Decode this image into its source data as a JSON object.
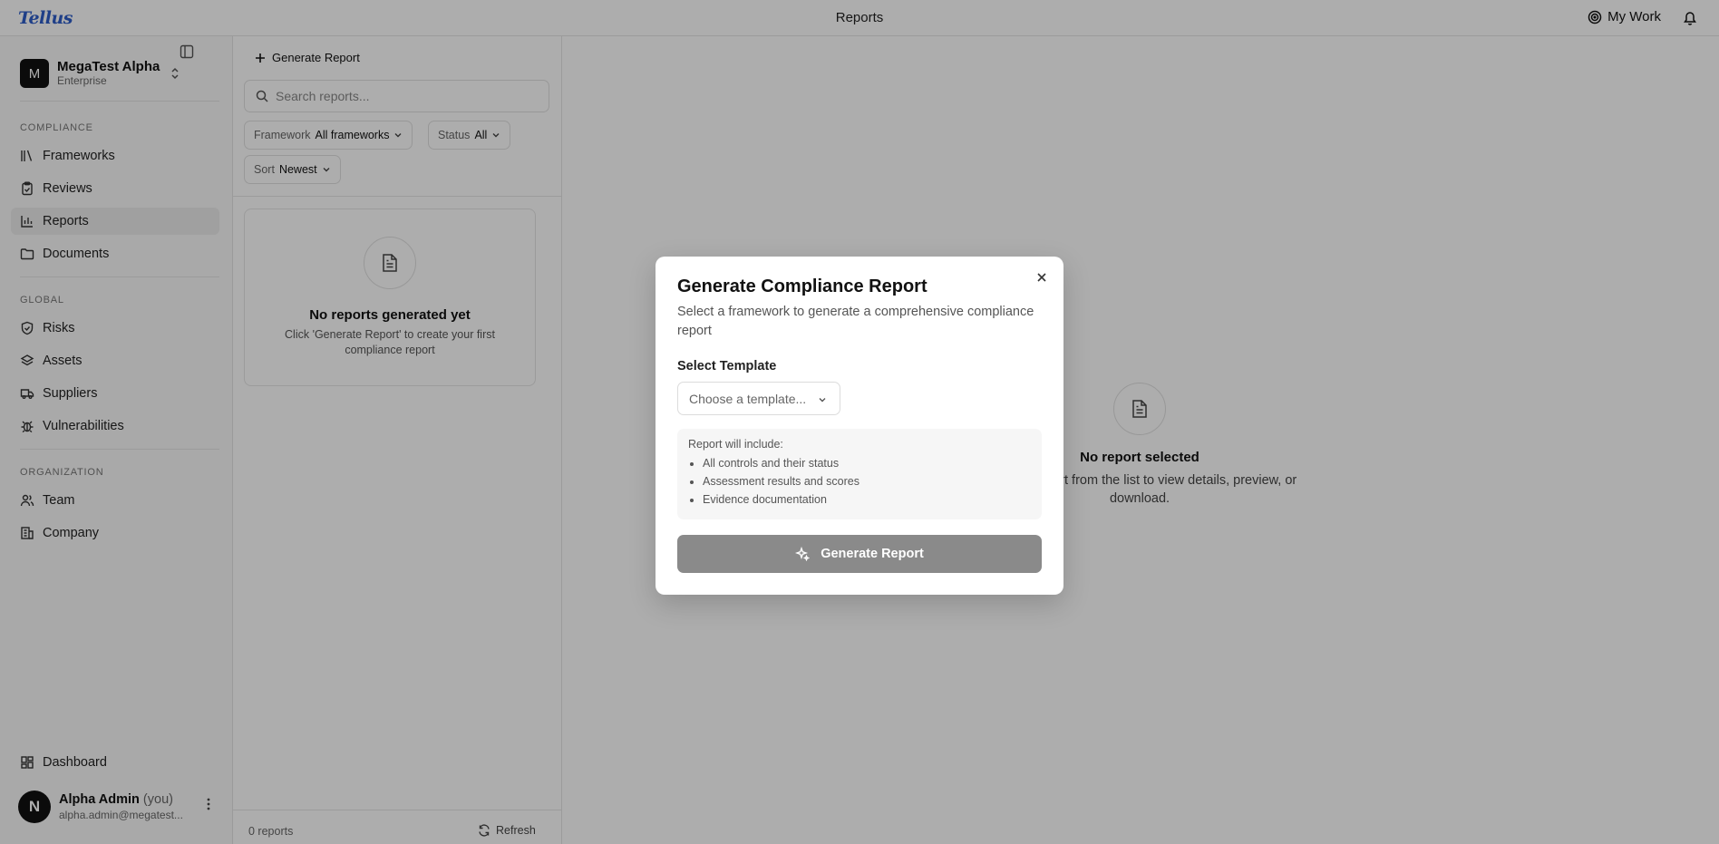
{
  "app": {
    "logo": "Tellus",
    "page_title": "Reports",
    "my_work": "My Work"
  },
  "org": {
    "initial": "M",
    "name": "MegaTest Alpha",
    "plan": "Enterprise"
  },
  "nav": {
    "compliance_label": "COMPLIANCE",
    "compliance": [
      {
        "label": "Frameworks",
        "icon": "frameworks-icon"
      },
      {
        "label": "Reviews",
        "icon": "clipboard-icon"
      },
      {
        "label": "Reports",
        "icon": "bar-chart-icon"
      },
      {
        "label": "Documents",
        "icon": "folder-icon"
      }
    ],
    "global_label": "GLOBAL",
    "global": [
      {
        "label": "Risks",
        "icon": "shield-icon"
      },
      {
        "label": "Assets",
        "icon": "layers-icon"
      },
      {
        "label": "Suppliers",
        "icon": "truck-icon"
      },
      {
        "label": "Vulnerabilities",
        "icon": "bug-icon"
      }
    ],
    "organization_label": "ORGANIZATION",
    "organization": [
      {
        "label": "Team",
        "icon": "users-icon"
      },
      {
        "label": "Company",
        "icon": "building-icon"
      }
    ],
    "dashboard": "Dashboard"
  },
  "user": {
    "initial": "N",
    "name": "Alpha Admin",
    "you": "(you)",
    "email": "alpha.admin@megatest..."
  },
  "list": {
    "generate_button": "Generate Report",
    "search_placeholder": "Search reports...",
    "filters": {
      "framework_label": "Framework",
      "framework_value": "All frameworks",
      "status_label": "Status",
      "status_value": "All",
      "sort_label": "Sort",
      "sort_value": "Newest"
    },
    "empty_title": "No reports generated yet",
    "empty_desc": "Click 'Generate Report' to create your first compliance report",
    "count": "0 reports",
    "refresh": "Refresh"
  },
  "detail": {
    "empty_title": "No report selected",
    "empty_desc": "Select a report from the list to view details, preview, or download."
  },
  "modal": {
    "title": "Generate Compliance Report",
    "description": "Select a framework to generate a comprehensive compliance report",
    "template_label": "Select Template",
    "template_placeholder": "Choose a template...",
    "includes_title": "Report will include:",
    "includes": [
      "All controls and their status",
      "Assessment results and scores",
      "Evidence documentation"
    ],
    "submit": "Generate Report"
  },
  "colors": {
    "brand": "#2f5ec9",
    "overlay": "#000000",
    "disabled_button": "#8a8a8a"
  }
}
